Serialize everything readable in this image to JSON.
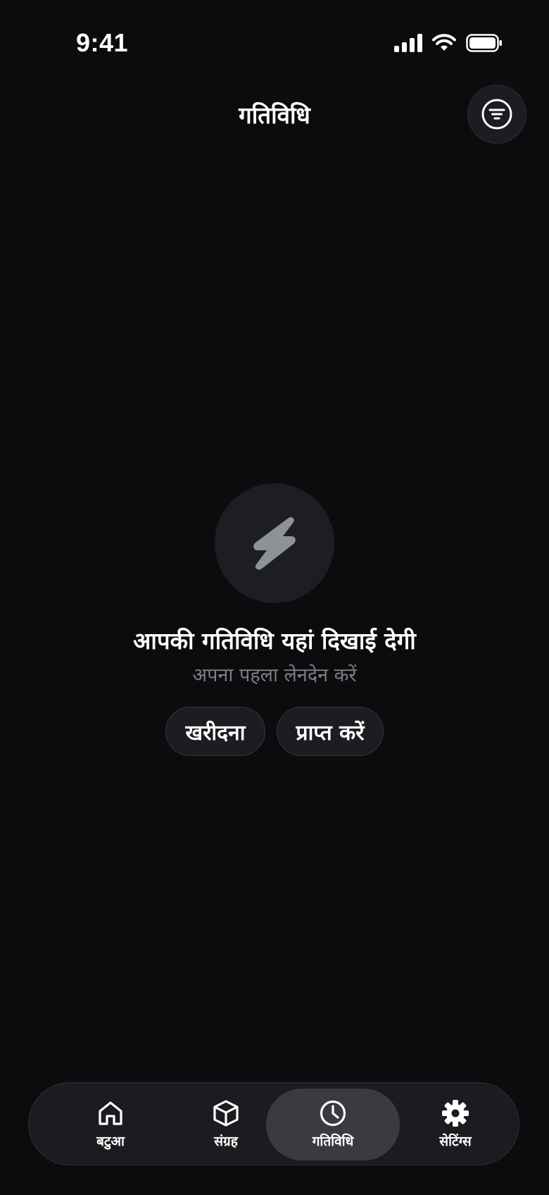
{
  "status_bar": {
    "time": "9:41",
    "icons": [
      "cellular-signal-icon",
      "wifi-icon",
      "battery-icon"
    ]
  },
  "header": {
    "title": "गतिविधि",
    "filter_icon": "filter-lines-icon"
  },
  "empty_state": {
    "icon": "lightning-bolt-icon",
    "title": "आपकी गतिविधि यहां दिखाई देगी",
    "subtitle": "अपना पहला लेनदेन करें"
  },
  "actions": {
    "buy_label": "खरीदना",
    "receive_label": "प्राप्त करें"
  },
  "tab_bar": {
    "active": "गतिविधि",
    "tabs": [
      {
        "label": "बटुआ",
        "icon": "home-icon"
      },
      {
        "label": "संग्रह",
        "icon": "cube-icon"
      },
      {
        "label": "गतिविधि",
        "icon": "clock-icon"
      },
      {
        "label": "सेटिंग्स",
        "icon": "gear-icon"
      }
    ]
  },
  "colors": {
    "background": "#0c0c0e",
    "surface": "#1c1d21",
    "active_tab": "#3a3b3f",
    "muted_text": "#7d7f85",
    "bolt_icon": "#8e9197"
  }
}
